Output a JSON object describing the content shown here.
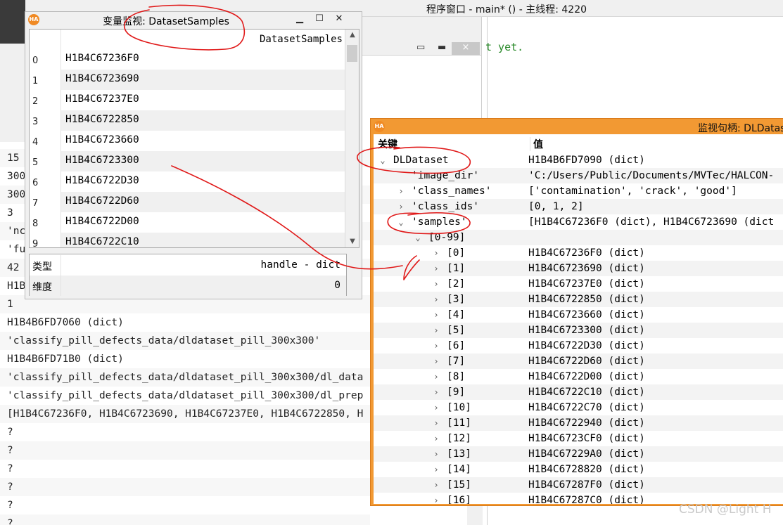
{
  "main_window": {
    "title": "程序窗口 - main* () - 主线程: 4220",
    "code_text": "t yet.",
    "mini_controls": {
      "restore": "▭",
      "minimize": "▬",
      "close": "×"
    }
  },
  "background_values": [
    "15",
    "300",
    "300",
    "3",
    "'nc",
    "'fu",
    "42",
    "H1B",
    "1",
    "H1B4B6FD7060 (dict)",
    "'classify_pill_defects_data/dldataset_pill_300x300'",
    "H1B4B6FD71B0 (dict)",
    "'classify_pill_defects_data/dldataset_pill_300x300/dl_data",
    "'classify_pill_defects_data/dldataset_pill_300x300/dl_prep",
    "[H1B4C67236F0, H1B4C6723690, H1B4C67237E0, H1B4C6722850, H",
    "?",
    "?",
    "?",
    "?",
    "?",
    "?"
  ],
  "var_window": {
    "logo": "HA",
    "title": "变量监视: DatasetSamples",
    "column_header": "DatasetSamples",
    "rows": [
      {
        "index": "0",
        "value": "H1B4C67236F0"
      },
      {
        "index": "1",
        "value": "H1B4C6723690"
      },
      {
        "index": "2",
        "value": "H1B4C67237E0"
      },
      {
        "index": "3",
        "value": "H1B4C6722850"
      },
      {
        "index": "4",
        "value": "H1B4C6723660"
      },
      {
        "index": "5",
        "value": "H1B4C6723300"
      },
      {
        "index": "6",
        "value": "H1B4C6722D30"
      },
      {
        "index": "7",
        "value": "H1B4C6722D60"
      },
      {
        "index": "8",
        "value": "H1B4C6722D00"
      },
      {
        "index": "9",
        "value": "H1B4C6722C10"
      }
    ],
    "props": [
      {
        "key": "类型",
        "value": "handle - dict"
      },
      {
        "key": "维度",
        "value": "0"
      }
    ]
  },
  "handle_window": {
    "logo": "HA",
    "title": "监视句柄: DLDataset",
    "header_key": "关键",
    "header_value": "值",
    "rows": [
      {
        "level": 0,
        "chevron": "expanded",
        "key": "DLDataset",
        "value": "H1B4B6FD7090 (dict)"
      },
      {
        "level": 1,
        "chevron": "none",
        "key": "'image_dir'",
        "value": "'C:/Users/Public/Documents/MVTec/HALCON-"
      },
      {
        "level": 1,
        "chevron": "collapsed",
        "key": "'class_names'",
        "value": "['contamination', 'crack', 'good']"
      },
      {
        "level": 1,
        "chevron": "collapsed",
        "key": "'class_ids'",
        "value": "[0, 1, 2]"
      },
      {
        "level": 1,
        "chevron": "expanded",
        "key": "'samples'",
        "value": "[H1B4C67236F0 (dict), H1B4C6723690 (dict"
      },
      {
        "level": 2,
        "chevron": "expanded",
        "key": "[0-99]",
        "value": ""
      },
      {
        "level": 3,
        "chevron": "collapsed",
        "key": "[0]",
        "value": "H1B4C67236F0 (dict)"
      },
      {
        "level": 3,
        "chevron": "collapsed",
        "key": "[1]",
        "value": "H1B4C6723690 (dict)"
      },
      {
        "level": 3,
        "chevron": "collapsed",
        "key": "[2]",
        "value": "H1B4C67237E0 (dict)"
      },
      {
        "level": 3,
        "chevron": "collapsed",
        "key": "[3]",
        "value": "H1B4C6722850 (dict)"
      },
      {
        "level": 3,
        "chevron": "collapsed",
        "key": "[4]",
        "value": "H1B4C6723660 (dict)"
      },
      {
        "level": 3,
        "chevron": "collapsed",
        "key": "[5]",
        "value": "H1B4C6723300 (dict)"
      },
      {
        "level": 3,
        "chevron": "collapsed",
        "key": "[6]",
        "value": "H1B4C6722D30 (dict)"
      },
      {
        "level": 3,
        "chevron": "collapsed",
        "key": "[7]",
        "value": "H1B4C6722D60 (dict)"
      },
      {
        "level": 3,
        "chevron": "collapsed",
        "key": "[8]",
        "value": "H1B4C6722D00 (dict)"
      },
      {
        "level": 3,
        "chevron": "collapsed",
        "key": "[9]",
        "value": "H1B4C6722C10 (dict)"
      },
      {
        "level": 3,
        "chevron": "collapsed",
        "key": "[10]",
        "value": "H1B4C6722C70 (dict)"
      },
      {
        "level": 3,
        "chevron": "collapsed",
        "key": "[11]",
        "value": "H1B4C6722940 (dict)"
      },
      {
        "level": 3,
        "chevron": "collapsed",
        "key": "[12]",
        "value": "H1B4C6723CF0 (dict)"
      },
      {
        "level": 3,
        "chevron": "collapsed",
        "key": "[13]",
        "value": "H1B4C67229A0 (dict)"
      },
      {
        "level": 3,
        "chevron": "collapsed",
        "key": "[14]",
        "value": "H1B4C6728820 (dict)"
      },
      {
        "level": 3,
        "chevron": "collapsed",
        "key": "[15]",
        "value": "H1B4C67287F0 (dict)"
      },
      {
        "level": 3,
        "chevron": "collapsed",
        "key": "[16]",
        "value": "H1B4C67287C0 (dict)"
      }
    ]
  },
  "watermark": "CSDN @Light H",
  "colors": {
    "annotation_red": "#e01818",
    "handle_window_border": "#f29933",
    "logo_orange": "#f08a24"
  }
}
